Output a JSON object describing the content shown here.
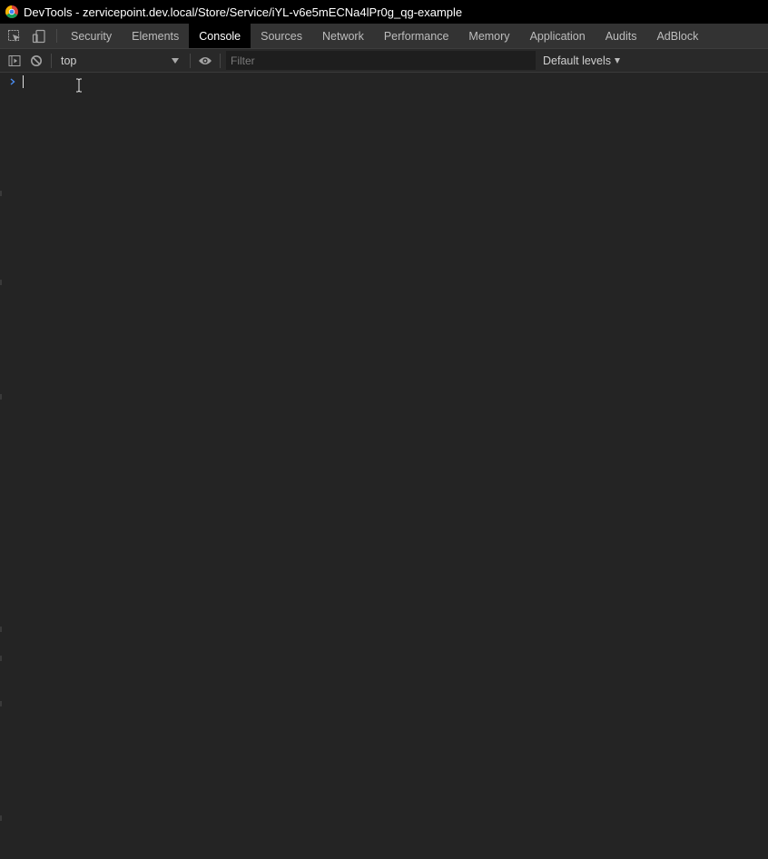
{
  "window": {
    "title": "DevTools - zervicepoint.dev.local/Store/Service/iYL-v6e5mECNa4lPr0g_qg-example",
    "icon": "chrome-icon"
  },
  "tabs": [
    {
      "label": "Security",
      "active": false
    },
    {
      "label": "Elements",
      "active": false
    },
    {
      "label": "Console",
      "active": true
    },
    {
      "label": "Sources",
      "active": false
    },
    {
      "label": "Network",
      "active": false
    },
    {
      "label": "Performance",
      "active": false
    },
    {
      "label": "Memory",
      "active": false
    },
    {
      "label": "Application",
      "active": false
    },
    {
      "label": "Audits",
      "active": false
    },
    {
      "label": "AdBlock",
      "active": false
    }
  ],
  "toolbar": {
    "context": "top",
    "filter_placeholder": "Filter",
    "filter_value": "",
    "levels": "Default levels"
  },
  "console": {
    "input": ""
  },
  "colors": {
    "background": "#242424",
    "titlebar": "#000000",
    "tabbar": "#333333",
    "active_tab": "#000000",
    "prompt_accent": "#4a8cf0"
  }
}
